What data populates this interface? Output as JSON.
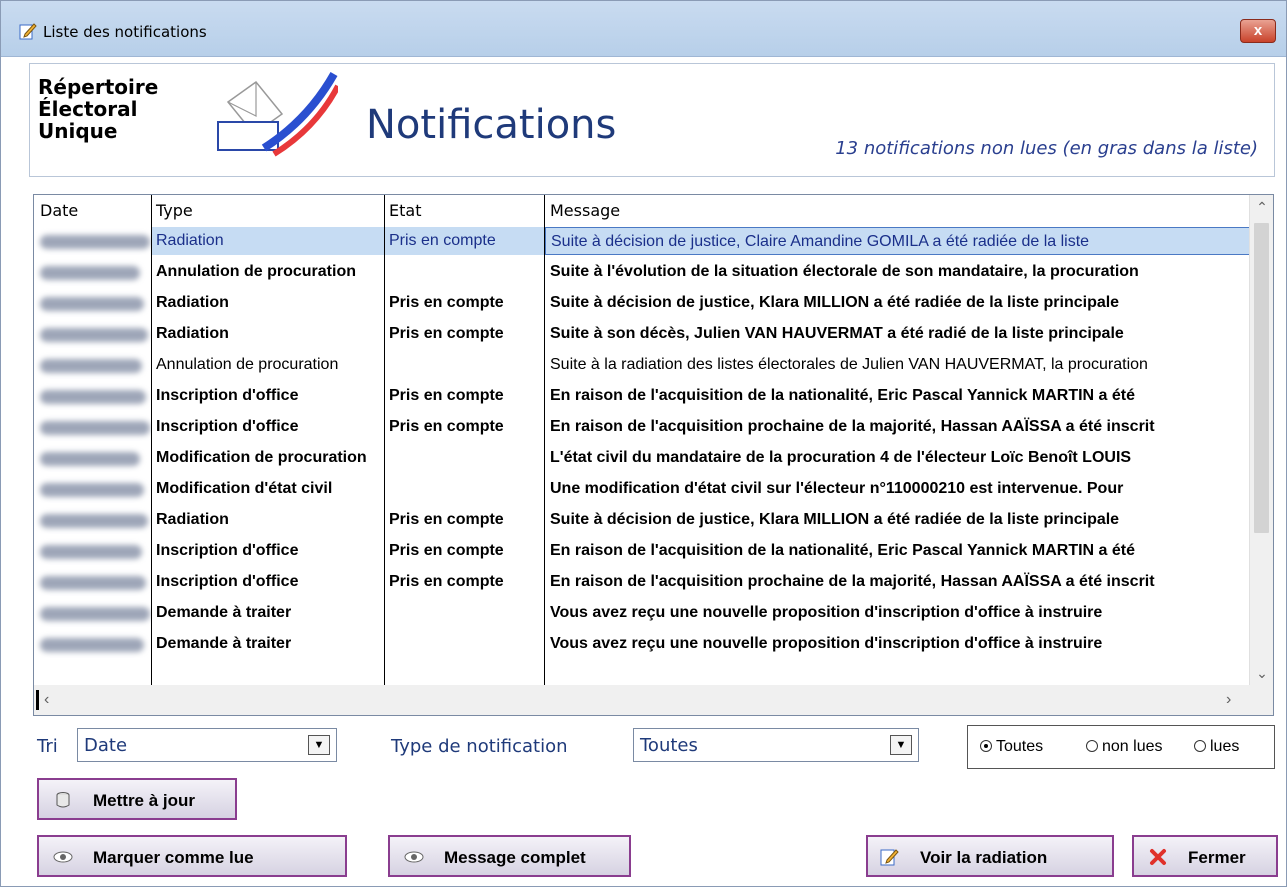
{
  "window": {
    "title": "Liste des notifications",
    "close_label": "x"
  },
  "header": {
    "logo_lines": [
      "Répertoire",
      "Électoral",
      "Unique"
    ],
    "title": "Notifications",
    "unread_info": "13 notifications non lues (en gras dans la liste)"
  },
  "table": {
    "columns": [
      "Date",
      "Type",
      "Etat",
      "Message"
    ],
    "rows": [
      {
        "type": "Radiation",
        "etat": "Pris en compte",
        "message": "Suite à décision de justice, Claire Amandine GOMILA a été radiée de la liste",
        "bold": false,
        "selected": true
      },
      {
        "type": "Annulation de procuration",
        "etat": "",
        "message": "Suite à l'évolution de la situation électorale de son mandataire, la procuration",
        "bold": true,
        "selected": false
      },
      {
        "type": "Radiation",
        "etat": "Pris en compte",
        "message": "Suite à décision de justice, Klara MILLION a été radiée de la liste principale",
        "bold": true,
        "selected": false
      },
      {
        "type": "Radiation",
        "etat": "Pris en compte",
        "message": "Suite à son décès, Julien VAN HAUVERMAT a été radié de la liste principale",
        "bold": true,
        "selected": false
      },
      {
        "type": "Annulation de procuration",
        "etat": "",
        "message": "Suite à la radiation des listes électorales de Julien VAN HAUVERMAT, la procuration",
        "bold": false,
        "selected": false
      },
      {
        "type": "Inscription d'office",
        "etat": "Pris en compte",
        "message": "En raison de l'acquisition de la nationalité, Eric Pascal Yannick MARTIN a été",
        "bold": true,
        "selected": false
      },
      {
        "type": "Inscription d'office",
        "etat": "Pris en compte",
        "message": "En raison de l'acquisition prochaine de la majorité, Hassan AAÏSSA a été inscrit",
        "bold": true,
        "selected": false
      },
      {
        "type": "Modification de procuration",
        "etat": "",
        "message": "L'état civil du mandataire de la procuration 4 de l'électeur Loïc Benoît LOUIS",
        "bold": true,
        "selected": false
      },
      {
        "type": "Modification d'état civil",
        "etat": "",
        "message": "Une modification d'état civil sur l'électeur n°110000210 est intervenue. Pour",
        "bold": true,
        "selected": false
      },
      {
        "type": "Radiation",
        "etat": "Pris en compte",
        "message": "Suite à décision de justice, Klara MILLION a été radiée de la liste principale",
        "bold": true,
        "selected": false
      },
      {
        "type": "Inscription d'office",
        "etat": "Pris en compte",
        "message": "En raison de l'acquisition de la nationalité, Eric Pascal Yannick MARTIN a été",
        "bold": true,
        "selected": false
      },
      {
        "type": "Inscription d'office",
        "etat": "Pris en compte",
        "message": "En raison de l'acquisition prochaine de la majorité, Hassan AAÏSSA a été inscrit",
        "bold": true,
        "selected": false
      },
      {
        "type": "Demande à traiter",
        "etat": "",
        "message": "Vous avez reçu une nouvelle proposition d'inscription d'office à instruire",
        "bold": true,
        "selected": false
      },
      {
        "type": "Demande à traiter",
        "etat": "",
        "message": "Vous avez reçu une nouvelle proposition d'inscription d'office à instruire",
        "bold": true,
        "selected": false
      }
    ]
  },
  "controls": {
    "sort_label": "Tri",
    "sort_value": "Date",
    "type_label": "Type de notification",
    "type_value": "Toutes",
    "radio_all": "Toutes",
    "radio_unread": "non lues",
    "radio_read": "lues"
  },
  "buttons": {
    "refresh": "Mettre à jour",
    "mark_read": "Marquer comme lue",
    "full_message": "Message complet",
    "view_radiation": "Voir la radiation",
    "close": "Fermer"
  },
  "colors": {
    "accent": "#1f3a7a",
    "selection": "#c6dcf3",
    "button_border": "#8a3d8f"
  }
}
